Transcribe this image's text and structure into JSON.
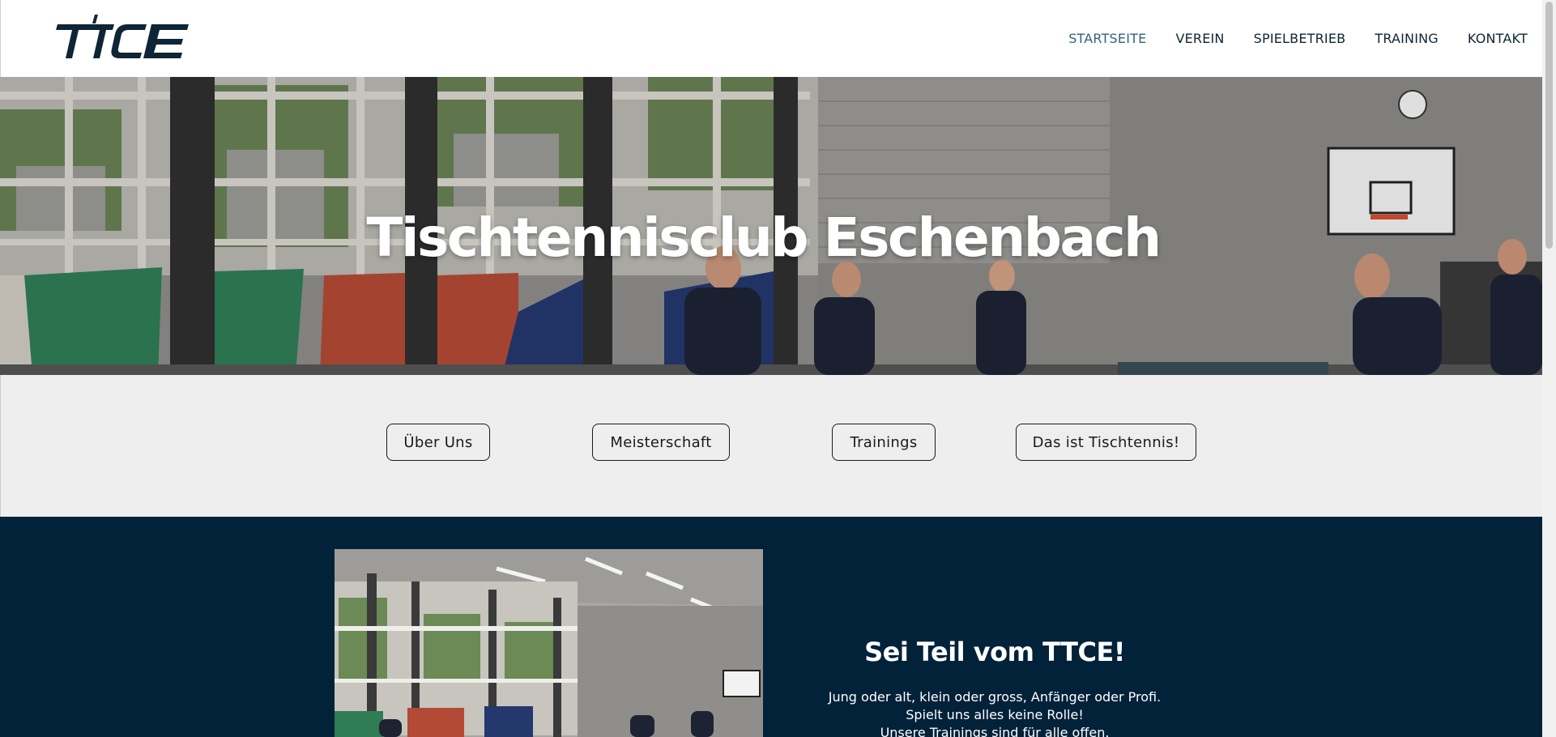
{
  "header": {
    "logo_text": "TTCE",
    "nav": [
      {
        "label": "STARTSEITE",
        "active": true
      },
      {
        "label": "VEREIN",
        "active": false
      },
      {
        "label": "SPIELBETRIEB",
        "active": false
      },
      {
        "label": "TRAINING",
        "active": false
      },
      {
        "label": "KONTAKT",
        "active": false
      }
    ]
  },
  "hero": {
    "title": "Tischtennisclub Eschenbach"
  },
  "quicklinks": [
    {
      "label": "Über Uns"
    },
    {
      "label": "Meisterschaft"
    },
    {
      "label": "Trainings"
    },
    {
      "label": "Das ist Tischtennis!"
    }
  ],
  "join": {
    "title": "Sei Teil vom TTCE!",
    "lines": [
      "Jung oder alt, klein oder gross, Anfänger oder Profi.",
      "Spielt uns alles keine Rolle!",
      "Unsere Trainings sind für alle offen."
    ]
  },
  "colors": {
    "nav_active": "#33627f",
    "text_dark": "#0e2535",
    "band_bg": "#eeeeee",
    "section_dark": "#02223a"
  }
}
